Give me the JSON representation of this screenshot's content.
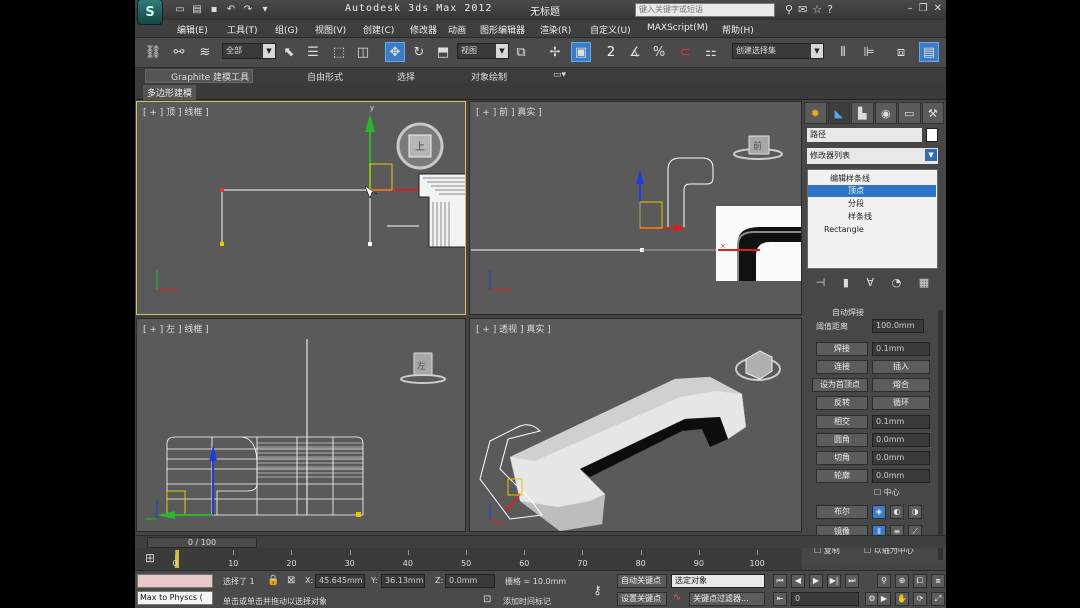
{
  "title": {
    "app": "Autodesk 3ds Max  2012",
    "file": "无标题",
    "search_placeholder": "键入关键字或短语"
  },
  "menu": [
    "编辑(E)",
    "工具(T)",
    "组(G)",
    "视图(V)",
    "创建(C)",
    "修改器",
    "动画",
    "图形编辑器",
    "渲染(R)",
    "自定义(U)",
    "MAXScript(M)",
    "帮助(H)"
  ],
  "toolbar": {
    "selection_filter": "全部",
    "ref_coord": "视图",
    "named_selection": "创建选择集",
    "snap_labels": [
      "2",
      "%",
      "n"
    ]
  },
  "ribbon": {
    "tabs": [
      "Graphite 建模工具",
      "自由形式",
      "选择",
      "对象绘制"
    ],
    "sub_tab": "多边形建模"
  },
  "viewports": {
    "top": {
      "label": "[ + ] 顶 ] 线框 ]",
      "cube_label": "上"
    },
    "front": {
      "label": "[ + ] 前 ] 真实 ]",
      "cube_label": "前"
    },
    "left": {
      "label": "[ + ] 左 ] 线框 ]",
      "cube_label": "左"
    },
    "persp": {
      "label": "[ + ] 透视 ] 真实 ]"
    }
  },
  "command_panel": {
    "object_name": "路径",
    "modifier_list": "修改器列表",
    "stack": [
      "编辑样条线",
      "顶点",
      "分段",
      "样条线",
      "Rectangle"
    ],
    "rollout": {
      "auto_weld": "自动焊接",
      "threshold_label": "阈值距离",
      "threshold_value": "100.0mm",
      "buttons": {
        "weld": "焊接",
        "connect": "连接",
        "make_first": "设为首顶点",
        "reverse": "反转",
        "cross": "相交",
        "fillet": "圆角",
        "chamfer": "切角",
        "outline": "轮廓",
        "insert": "插入",
        "fuse": "熔合",
        "cycle": "循环",
        "boolean": "布尔",
        "mirror": "镜像"
      },
      "weld_value": "0.1mm",
      "cross_value": "0.1mm",
      "fillet_value": "0.0mm",
      "chamfer_value": "0.0mm",
      "outline_value": "0.0mm",
      "center_label": "中心",
      "copy_label": "复制",
      "axis_label": "以轴为中心"
    }
  },
  "timeline": {
    "slider": "0 / 100",
    "ticks": [
      "0",
      "10",
      "20",
      "30",
      "40",
      "50",
      "60",
      "70",
      "80",
      "90",
      "100"
    ]
  },
  "status": {
    "script_listener": "Max to Physcs (",
    "selected": "选择了 1",
    "x_label": "X:",
    "x_value": "45.645mm",
    "y_label": "Y:",
    "y_value": "36.13mm",
    "z_label": "Z:",
    "z_value": "0.0mm",
    "grid": "栅格 = 10.0mm",
    "prompt": "单击或单击并拖动以选择对象",
    "add_time_tag": "添加时间标记",
    "auto_key": "自动关键点",
    "set_key": "设置关键点",
    "selected_obj": "选定对象",
    "key_filters": "关键点过滤器...",
    "frame": "0"
  }
}
